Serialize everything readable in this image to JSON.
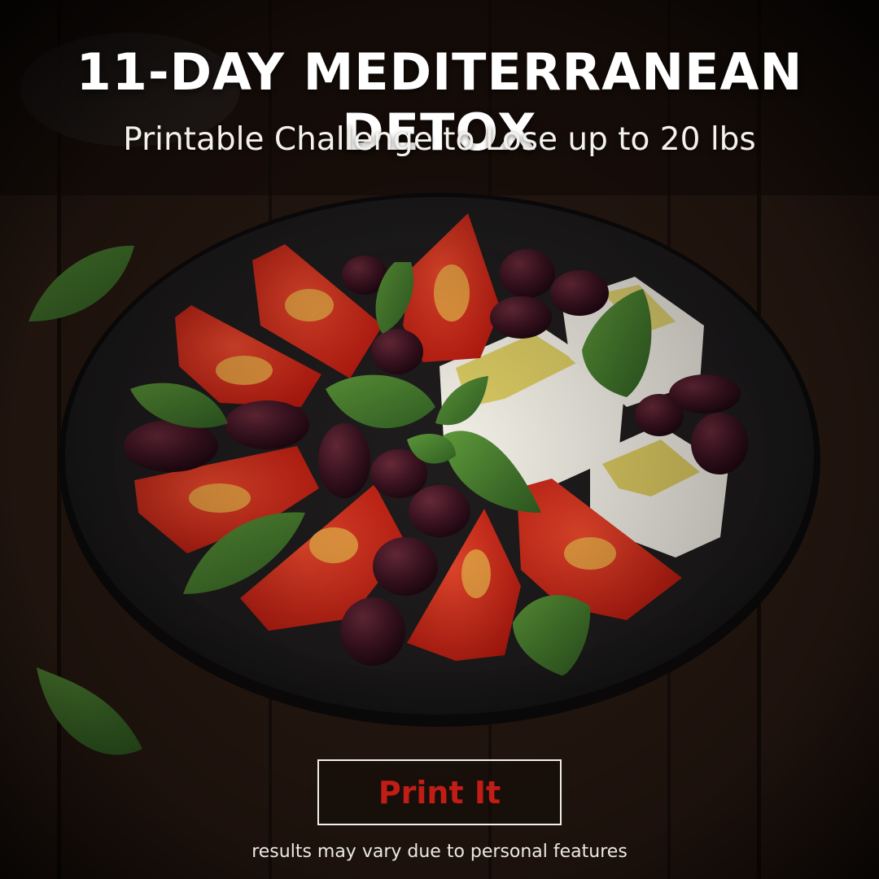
{
  "header": {
    "title": "11-DAY MEDITERRANEAN DETOX",
    "subtitle": "Printable Challenge to Lose up to 20 lbs"
  },
  "cta": {
    "label": "Print It"
  },
  "footer": {
    "disclaimer": "results may vary due to personal features"
  },
  "colors": {
    "background": "#1b120d",
    "title_text": "#ffffff",
    "cta_text": "#c01d16",
    "cta_border": "#f2efe9"
  },
  "scene": {
    "description_icon": "salad-plate-icon",
    "items": [
      "tomato",
      "kalamata-olive",
      "feta",
      "basil-leaf"
    ]
  }
}
